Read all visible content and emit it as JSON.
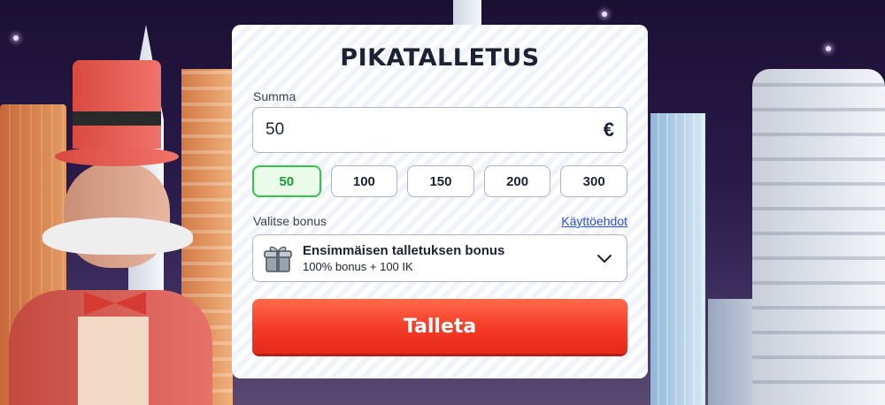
{
  "deposit": {
    "title": "PIKATALLETUS",
    "amount_label": "Summa",
    "amount_value": "50",
    "currency_symbol": "€",
    "presets": [
      "50",
      "100",
      "150",
      "200",
      "300"
    ],
    "selected_preset": "50",
    "bonus_label": "Valitse bonus",
    "terms_link": "Käyttöehdot",
    "bonus": {
      "title": "Ensimmäisen talletuksen bonus",
      "subtitle": "100% bonus + 100 IK",
      "icon": "gift-box-icon"
    },
    "submit_label": "Talleta"
  },
  "colors": {
    "accent_red": "#f43a26",
    "selected_green": "#34c24a",
    "link_blue": "#2a4fd6",
    "text_dark": "#1c2233"
  }
}
